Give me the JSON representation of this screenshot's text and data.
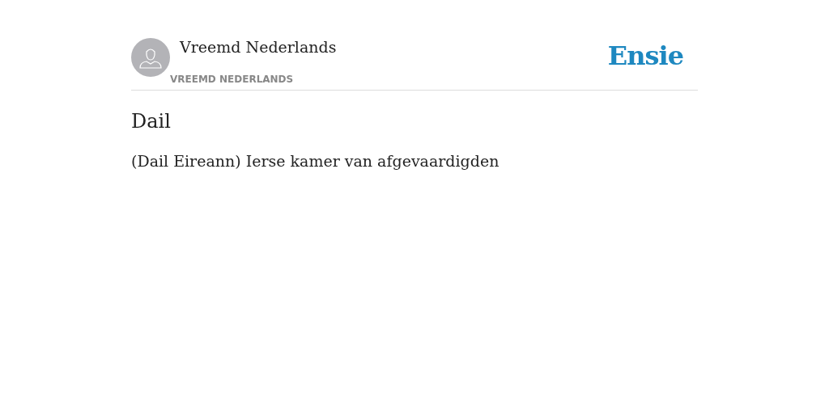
{
  "header": {
    "author": "Vreemd Nederlands",
    "category": "VREEMD NEDERLANDS",
    "logo": "Ensie"
  },
  "entry": {
    "title": "Dail",
    "definition": "(Dail Eireann) Ierse kamer van afgevaardigden"
  }
}
